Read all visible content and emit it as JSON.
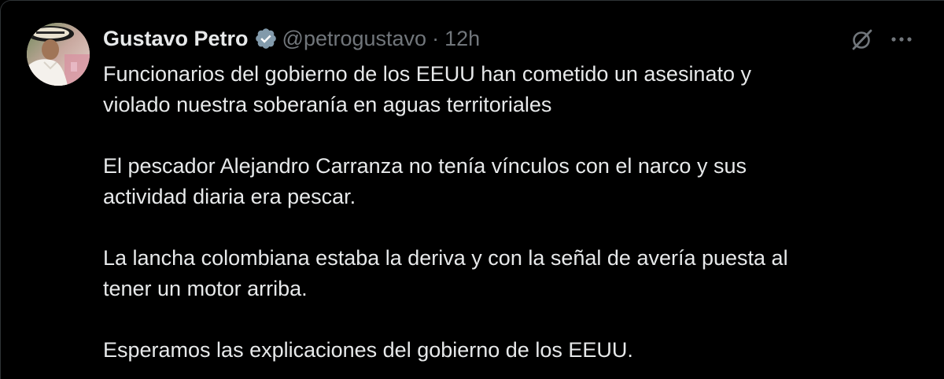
{
  "tweet": {
    "author": {
      "display_name": "Gustavo Petro",
      "handle": "@petrogustavo",
      "verified": true,
      "avatar_icon": "profile-photo"
    },
    "separator": "·",
    "time": "12h",
    "paragraphs": [
      [
        "Funcionarios del gobierno de los EEUU han cometido un asesinato y",
        "violado nuestra soberanía en aguas territoriales"
      ],
      [
        "El pescador Alejandro Carranza no tenía vínculos con el narco y sus",
        "actividad diaria era pescar."
      ],
      [
        "La lancha colombiana estaba la deriva y con la señal de avería puesta al",
        "tener un motor arriba."
      ],
      [
        "Esperamos las explicaciones del gobierno de los EEUU."
      ]
    ]
  },
  "icons": {
    "verified": "verified-badge-icon",
    "grok": "grok-icon",
    "more": "more-options-icon"
  },
  "colors": {
    "background": "#000000",
    "text": "#e7e9ea",
    "secondary": "#71767b",
    "link": "#1d9bf0",
    "border": "#2f3336"
  }
}
